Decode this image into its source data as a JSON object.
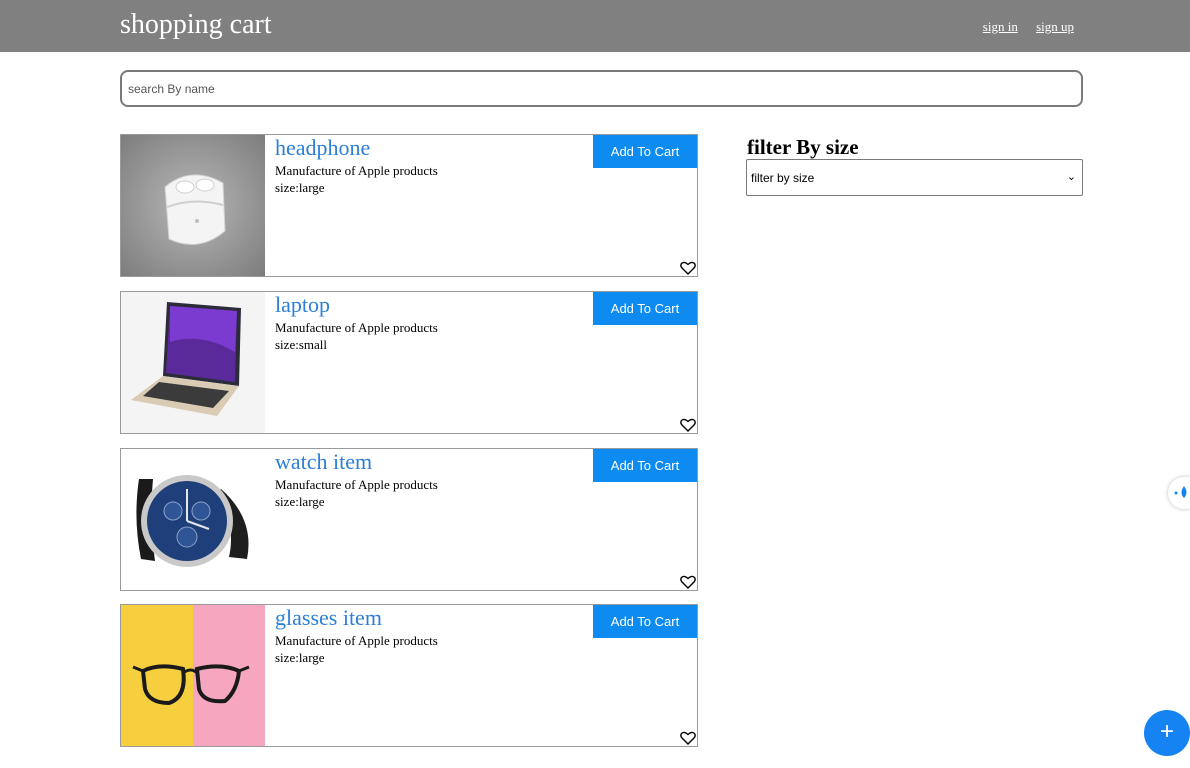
{
  "header": {
    "brand": "shopping cart",
    "sign_in": "sign in",
    "sign_up": "sign up"
  },
  "search": {
    "placeholder": "search By name",
    "value": ""
  },
  "products": [
    {
      "title": "headphone",
      "description": "Manufacture of Apple products",
      "size": "size:large",
      "button": "Add To Cart",
      "icon": "airpods-image"
    },
    {
      "title": "laptop",
      "description": "Manufacture of Apple products",
      "size": "size:small",
      "button": "Add To Cart",
      "icon": "laptop-image"
    },
    {
      "title": "watch item",
      "description": "Manufacture of Apple products",
      "size": "size:large",
      "button": "Add To Cart",
      "icon": "watch-image"
    },
    {
      "title": "glasses item",
      "description": "Manufacture of Apple products",
      "size": "size:large",
      "button": "Add To Cart",
      "icon": "glasses-image"
    }
  ],
  "filter": {
    "title": "filter By size",
    "selected": "filter by size"
  },
  "fab": {
    "label": "+"
  },
  "colors": {
    "header_bg": "#808080",
    "accent": "#0d8bf0",
    "title_link": "#2b7fd6"
  }
}
